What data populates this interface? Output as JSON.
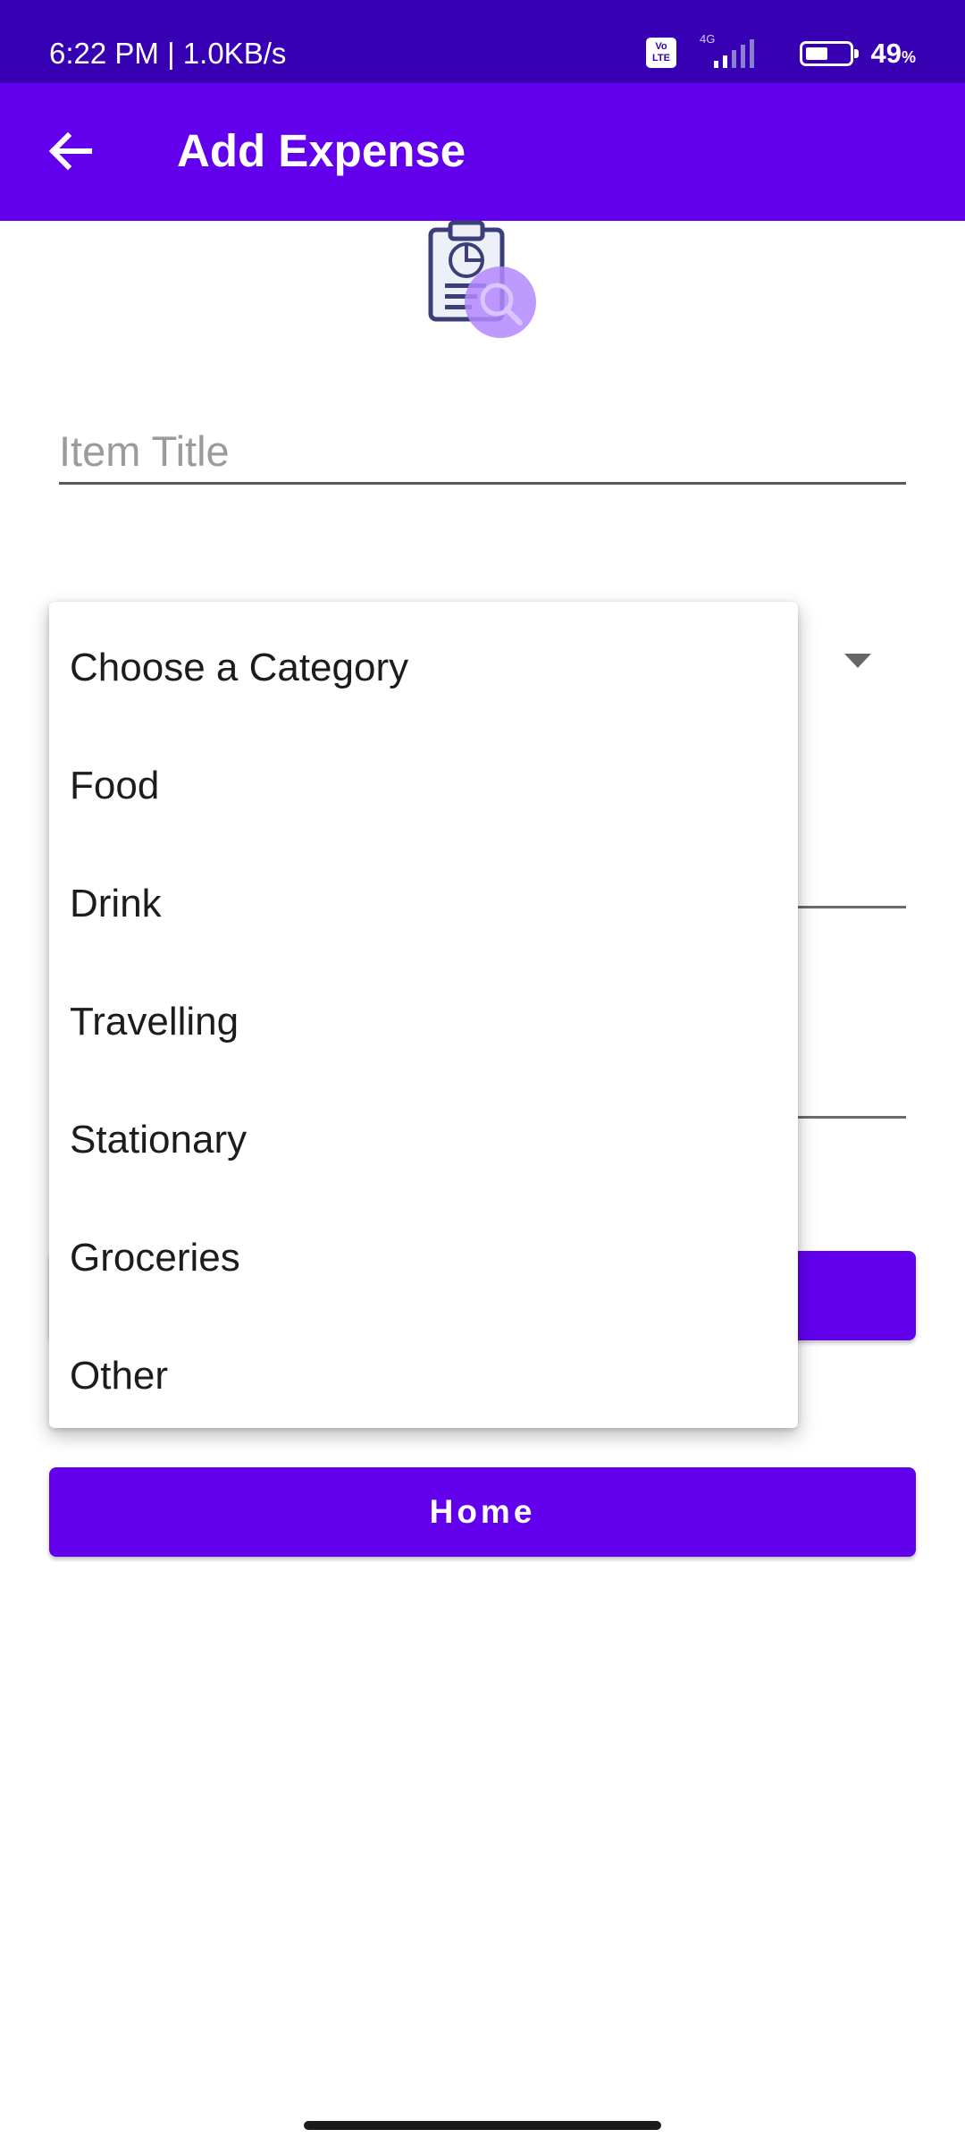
{
  "status_bar": {
    "time_speed": "6:22 PM | 1.0KB/s",
    "volte_label": "Vo LTE",
    "network_label": "4G",
    "battery_value": "49",
    "battery_unit": "%"
  },
  "app_bar": {
    "title": "Add Expense",
    "back_icon": "arrow-left-icon"
  },
  "form": {
    "item_title_placeholder": "Item Title",
    "item_title_value": ""
  },
  "dropdown": {
    "options": [
      "Choose a Category",
      "Food",
      "Drink",
      "Travelling",
      "Stationary",
      "Groceries",
      "Other"
    ]
  },
  "buttons": {
    "home_label": "Home"
  },
  "colors": {
    "status_bar": "#3700b3",
    "primary": "#6200ee"
  }
}
